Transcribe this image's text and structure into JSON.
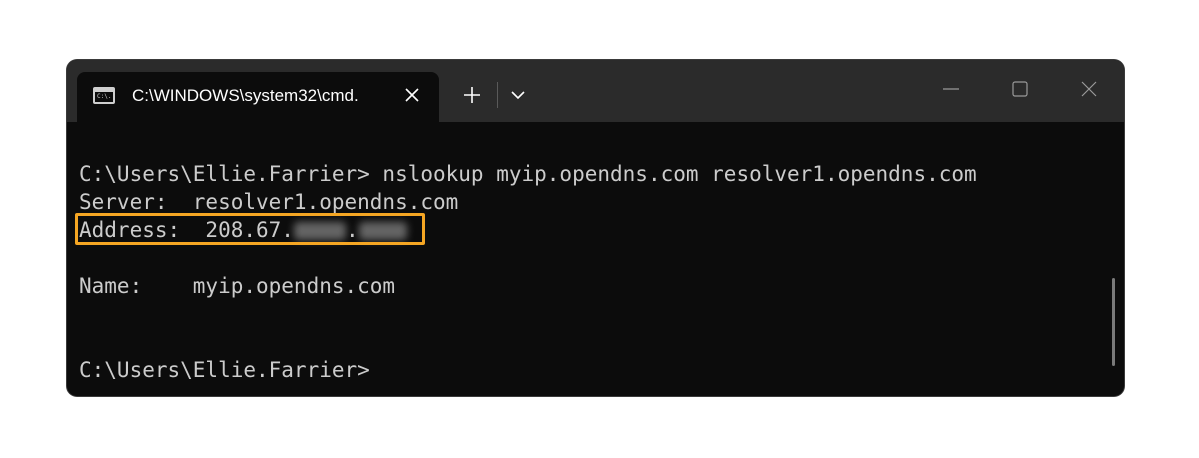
{
  "window": {
    "tab_title": "C:\\WINDOWS\\system32\\cmd.",
    "tab_icon_text": "C:\\."
  },
  "terminal": {
    "lines": [
      "C:\\Users\\Ellie.Farrier> nslookup myip.opendns.com resolver1.opendns.com",
      "Server:  resolver1.opendns.com",
      "Address:  208.67.",
      "",
      "Name:    myip.opendns.com",
      "",
      "",
      "C:\\Users\\Ellie.Farrier>"
    ],
    "address_separator": "."
  },
  "colors": {
    "terminal_bg": "#0c0c0c",
    "titlebar_bg": "#2b2b2b",
    "text": "#cccccc",
    "highlight_border": "#f5a623"
  }
}
